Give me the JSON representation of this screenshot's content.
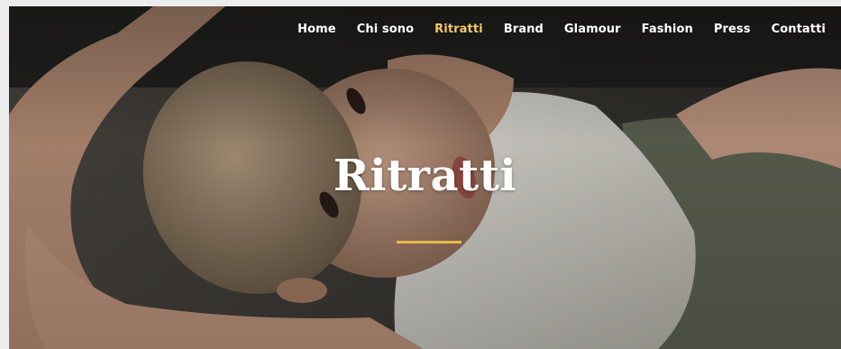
{
  "nav": {
    "items": [
      {
        "label": "Home",
        "active": false
      },
      {
        "label": "Chi sono",
        "active": false
      },
      {
        "label": "Ritratti",
        "active": true
      },
      {
        "label": "Brand",
        "active": false
      },
      {
        "label": "Glamour",
        "active": false
      },
      {
        "label": "Fashion",
        "active": false
      },
      {
        "label": "Press",
        "active": false
      },
      {
        "label": "Contatti",
        "active": false
      }
    ]
  },
  "hero": {
    "title": "Ritratti",
    "accent_color": "#e6b94b",
    "active_nav_color": "#f2c96a"
  }
}
